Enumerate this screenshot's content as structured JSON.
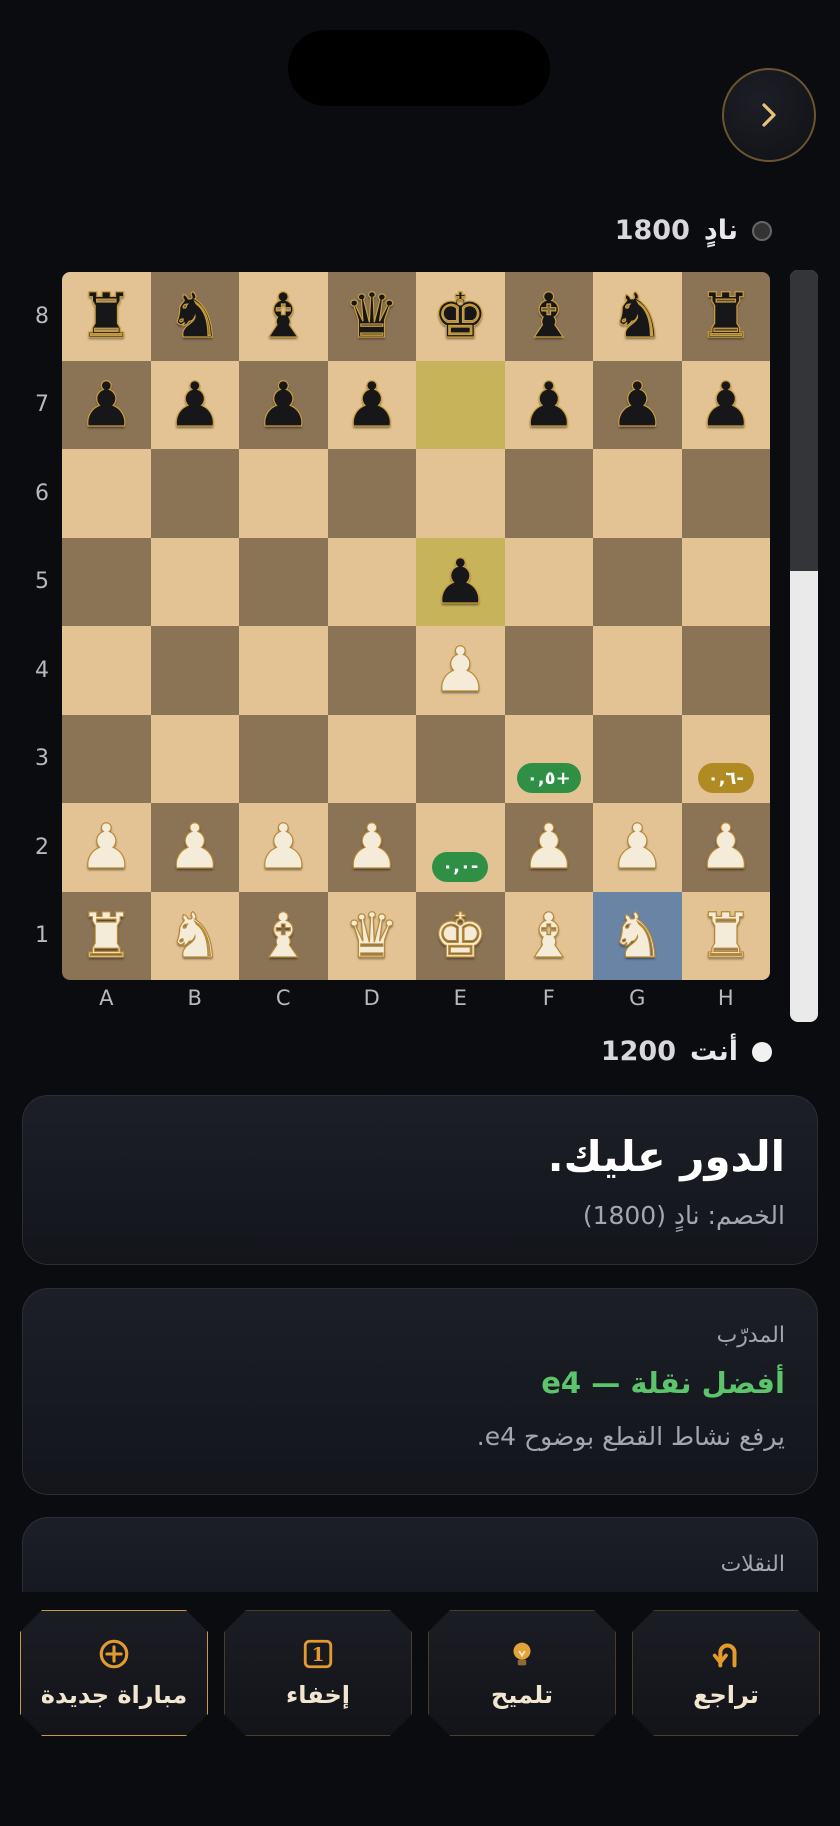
{
  "top_player": {
    "name": "نادٍ",
    "rating": "1800"
  },
  "bottom_player": {
    "name": "أنت",
    "rating": "1200"
  },
  "board": {
    "ranks": [
      "8",
      "7",
      "6",
      "5",
      "4",
      "3",
      "2",
      "1"
    ],
    "files": [
      "A",
      "B",
      "C",
      "D",
      "E",
      "F",
      "G",
      "H"
    ],
    "position": [
      [
        "br",
        "bn",
        "bb",
        "bq",
        "bk",
        "bb",
        "bn",
        "br"
      ],
      [
        "bp",
        "bp",
        "bp",
        "bp",
        "",
        "bp",
        "bp",
        "bp"
      ],
      [
        "",
        "",
        "",
        "",
        "",
        "",
        "",
        ""
      ],
      [
        "",
        "",
        "",
        "",
        "bp",
        "",
        "",
        ""
      ],
      [
        "",
        "",
        "",
        "",
        "wp",
        "",
        "",
        ""
      ],
      [
        "",
        "",
        "",
        "",
        "",
        "",
        "",
        ""
      ],
      [
        "wp",
        "wp",
        "wp",
        "wp",
        "",
        "wp",
        "wp",
        "wp"
      ],
      [
        "wr",
        "wn",
        "wb",
        "wq",
        "wk",
        "wb",
        "wn",
        "wr"
      ]
    ],
    "last_move_squares": [
      "e7",
      "e5"
    ],
    "selected_square": "g1",
    "eval_badges": [
      {
        "square": "f3",
        "text": "+٠,٥",
        "color": "#2f8f45"
      },
      {
        "square": "h3",
        "text": "-٠,٦",
        "color": "#b08b24"
      },
      {
        "square": "e2",
        "text": "-٠,٠",
        "color": "#2f8f45"
      }
    ],
    "eval_bar_black_fraction": 0.4
  },
  "status": {
    "title": "الدور عليك.",
    "subtitle": "الخصم: نادٍ (1800)"
  },
  "coach": {
    "label": "المدرّب",
    "best_move": "أفضل نقلة — e4",
    "explanation": "يرفع نشاط القطع بوضوح e4."
  },
  "moves": {
    "label": "النقلات"
  },
  "actions": [
    {
      "label": "تراجع",
      "icon": "undo-icon"
    },
    {
      "label": "تلميح",
      "icon": "bulb-icon"
    },
    {
      "label": "إخفاء",
      "icon": "number-one-icon"
    },
    {
      "label": "مباراة جديدة",
      "icon": "plus-circle-icon"
    }
  ],
  "colors": {
    "accent_gold": "#c59b4a",
    "coach_green": "#5cc46a",
    "light_square": "#e3c393",
    "dark_square": "#8b7356"
  }
}
